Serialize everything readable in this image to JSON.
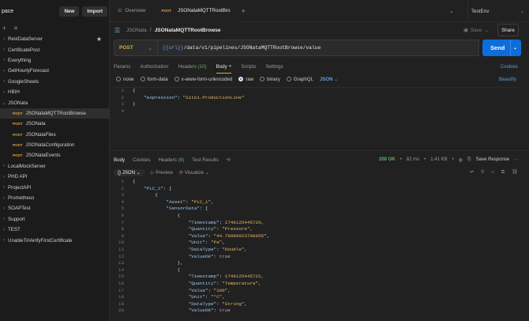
{
  "sidebar": {
    "workspace_name": "pace",
    "new_label": "New",
    "import_label": "Import",
    "items": [
      {
        "label": "RestDataServer",
        "starred": true
      },
      {
        "label": "CertificatePost"
      },
      {
        "label": "Everything"
      },
      {
        "label": "GetHourlyForecast"
      },
      {
        "label": "GoogleSheets"
      },
      {
        "label": "HBIH"
      },
      {
        "label": "JSONata",
        "expanded": true
      },
      {
        "label": "JSONataMQTTRootBrowse",
        "method": "POST",
        "child": true,
        "selected": true
      },
      {
        "label": "JSONata",
        "method": "POST",
        "child": true
      },
      {
        "label": "JSONataFiles",
        "method": "POST",
        "child": true
      },
      {
        "label": "JSONataConfiguration",
        "method": "POST",
        "child": true
      },
      {
        "label": "JSONataEvents",
        "method": "POST",
        "child": true
      },
      {
        "label": "LocalMockServer"
      },
      {
        "label": "PHD API"
      },
      {
        "label": "ProjectAPI"
      },
      {
        "label": "Prometheus"
      },
      {
        "label": "SOAPTest"
      },
      {
        "label": "Support"
      },
      {
        "label": "TEST"
      },
      {
        "label": "UnableToVerifyFirstCertificate"
      }
    ]
  },
  "tabs": {
    "overview_label": "Overview",
    "active_method": "POST",
    "active_label": "JSONataMQTTRootBro",
    "environment": "TestEnv"
  },
  "breadcrumb": {
    "parent": "JSONata",
    "current": "JSONataMQTTRootBrowse",
    "save_label": "Save",
    "share_label": "Share"
  },
  "request": {
    "method": "POST",
    "url_var": "{{url}}",
    "url_path": "/data/v1/pipelines/JSONataMQTTRootBrowse/value",
    "send_label": "Send",
    "tabs": {
      "params": "Params",
      "authorization": "Authorization",
      "headers": "Headers",
      "headers_count": "(10)",
      "body": "Body",
      "scripts": "Scripts",
      "settings": "Settings",
      "cookies": "Cookies"
    },
    "body_types": {
      "none": "none",
      "form_data": "form-data",
      "urlencoded": "x-www-form-urlencoded",
      "raw": "raw",
      "binary": "binary",
      "graphql": "GraphQL",
      "format": "JSON",
      "beautify": "Beautify"
    },
    "body_lines": [
      {
        "n": "1",
        "text": "{"
      },
      {
        "n": "2",
        "text": "    \"expression\": \"Site1.ProductionLine\""
      },
      {
        "n": "3",
        "text": "}"
      },
      {
        "n": "4",
        "text": ""
      }
    ]
  },
  "response": {
    "tabs": {
      "body": "Body",
      "cookies": "Cookies",
      "headers": "Headers",
      "headers_count": "(8)",
      "test_results": "Test Results"
    },
    "status": "200 OK",
    "time": "82 ms",
    "size": "1.41 KB",
    "save_response": "Save Response",
    "format": "JSON",
    "preview": "Preview",
    "visualize": "Visualize",
    "lines": [
      {
        "n": "1",
        "text": "{"
      },
      {
        "n": "2",
        "text": "    \"PLC_1\": ["
      },
      {
        "n": "3",
        "text": "        {"
      },
      {
        "n": "4",
        "text": "            \"Asset\": \"PLC_1\","
      },
      {
        "n": "5",
        "text": "            \"SensorData\": ["
      },
      {
        "n": "6",
        "text": "                {"
      },
      {
        "n": "7",
        "text": "                    \"Timestamp\": 1746125445720,"
      },
      {
        "n": "8",
        "text": "                    \"Quantity\": \"Pressure\","
      },
      {
        "n": "9",
        "text": "                    \"Value\": \"44.79999923706055\","
      },
      {
        "n": "10",
        "text": "                    \"Unit\": \"Pa\","
      },
      {
        "n": "11",
        "text": "                    \"DataType\": \"Double\","
      },
      {
        "n": "12",
        "text": "                    \"ValueOK\": true"
      },
      {
        "n": "13",
        "text": "                },"
      },
      {
        "n": "14",
        "text": "                {"
      },
      {
        "n": "15",
        "text": "                    \"Timestamp\": 1746125445722,"
      },
      {
        "n": "16",
        "text": "                    \"Quantity\": \"Temperature\","
      },
      {
        "n": "17",
        "text": "                    \"Value\": \"100\","
      },
      {
        "n": "18",
        "text": "                    \"Unit\": \"°C\","
      },
      {
        "n": "19",
        "text": "                    \"DataType\": \"String\","
      },
      {
        "n": "20",
        "text": "                    \"ValueOK\": true"
      }
    ]
  }
}
